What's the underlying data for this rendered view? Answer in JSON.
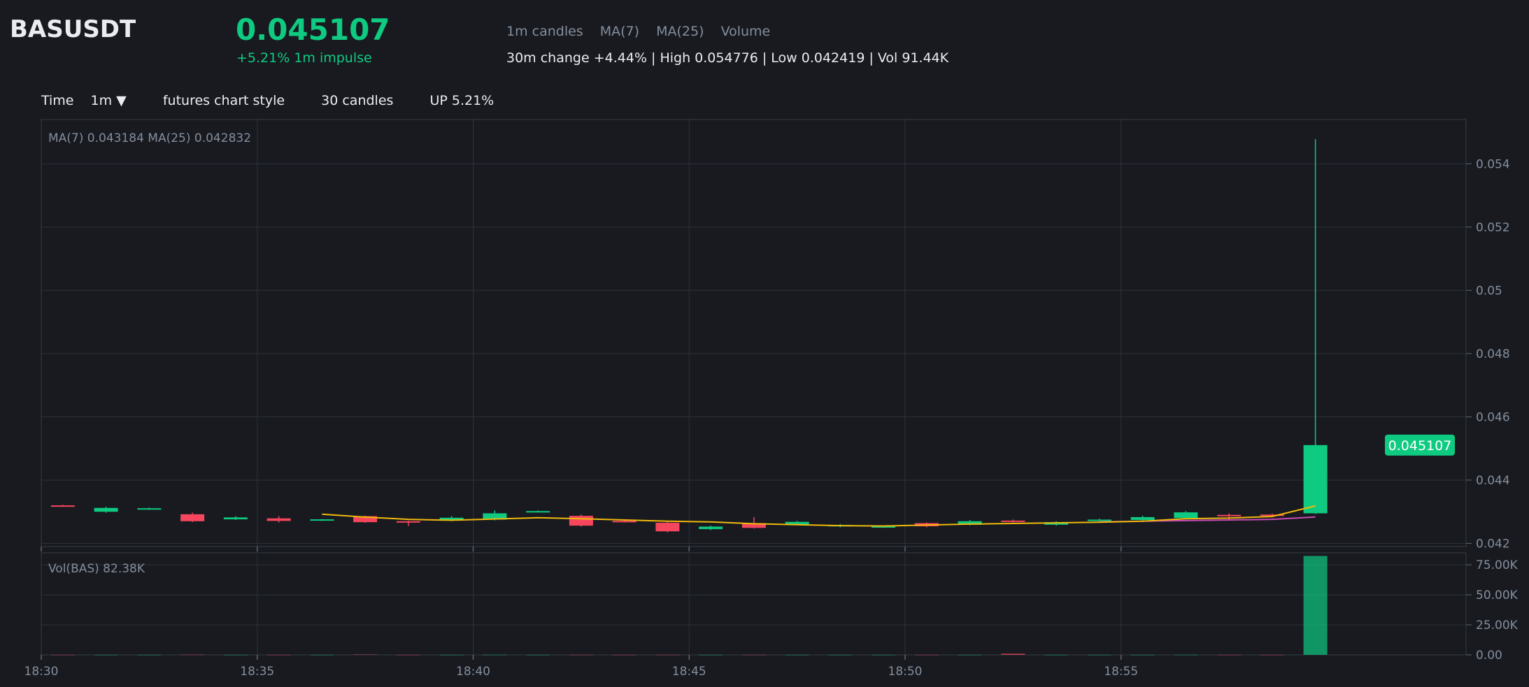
{
  "header": {
    "symbol": "BASUSDT",
    "price": "0.045107",
    "impulse": "+5.21% 1m impulse",
    "legend": [
      "1m candles",
      "MA(7)",
      "MA(25)",
      "Volume"
    ],
    "stats": "30m change +4.44% | High 0.054776 | Low 0.042419 | Vol 91.44K"
  },
  "toolbar": {
    "time_label": "Time",
    "interval": "1m ▼",
    "style": "futures chart style",
    "candles": "30 candles",
    "direction": "UP 5.21%"
  },
  "colors": {
    "background": "#181a20",
    "up": "#0ecb81",
    "down": "#f6465d",
    "ma7": "#f0b90b",
    "ma25": "#c94bb3",
    "grid": "#2b3139",
    "text_muted": "#848e9c"
  },
  "chart_data": {
    "type": "candlestick",
    "price_legend": "MA(7) 0.043184    MA(25) 0.042832",
    "volume_legend": "Vol(BAS) 82.38K",
    "last_price_label": "0.045107",
    "x_ticks": [
      "18:30",
      "18:35",
      "18:40",
      "18:45",
      "18:50",
      "18:55"
    ],
    "y_ticks": [
      "0.054",
      "0.052",
      "0.05",
      "0.048",
      "0.046",
      "0.044",
      "0.042"
    ],
    "y_tick_values": [
      0.054,
      0.052,
      0.05,
      0.048,
      0.046,
      0.044,
      0.042
    ],
    "ylim": [
      0.0419,
      0.0554
    ],
    "vol_ticks": [
      "75.00K",
      "50.00K",
      "25.00K",
      "0.00"
    ],
    "vol_tick_values": [
      75000,
      50000,
      25000,
      0
    ],
    "vol_ylim": [
      0,
      85000
    ],
    "candles": [
      {
        "t": "18:30",
        "o": 0.0432,
        "h": 0.04322,
        "l": 0.04318,
        "c": 0.04319,
        "v": 50
      },
      {
        "t": "18:31",
        "o": 0.043,
        "h": 0.04316,
        "l": 0.04297,
        "c": 0.04312,
        "v": 50
      },
      {
        "t": "18:32",
        "o": 0.04308,
        "h": 0.04313,
        "l": 0.04306,
        "c": 0.04311,
        "v": 50
      },
      {
        "t": "18:33",
        "o": 0.04292,
        "h": 0.04297,
        "l": 0.04267,
        "c": 0.0427,
        "v": 200
      },
      {
        "t": "18:34",
        "o": 0.04276,
        "h": 0.04286,
        "l": 0.04274,
        "c": 0.04282,
        "v": 50
      },
      {
        "t": "18:35",
        "o": 0.04279,
        "h": 0.04286,
        "l": 0.04266,
        "c": 0.04271,
        "v": 50
      },
      {
        "t": "18:36",
        "o": 0.04274,
        "h": 0.04277,
        "l": 0.04271,
        "c": 0.04276,
        "v": 50
      },
      {
        "t": "18:37",
        "o": 0.04286,
        "h": 0.04288,
        "l": 0.04265,
        "c": 0.04267,
        "v": 300
      },
      {
        "t": "18:38",
        "o": 0.0427,
        "h": 0.04272,
        "l": 0.04255,
        "c": 0.04268,
        "v": 50
      },
      {
        "t": "18:39",
        "o": 0.04272,
        "h": 0.04286,
        "l": 0.0427,
        "c": 0.04281,
        "v": 50
      },
      {
        "t": "18:40",
        "o": 0.04275,
        "h": 0.04304,
        "l": 0.04273,
        "c": 0.04295,
        "v": 100
      },
      {
        "t": "18:41",
        "o": 0.043,
        "h": 0.04304,
        "l": 0.04298,
        "c": 0.04302,
        "v": 50
      },
      {
        "t": "18:42",
        "o": 0.04287,
        "h": 0.04291,
        "l": 0.04253,
        "c": 0.04256,
        "v": 100
      },
      {
        "t": "18:43",
        "o": 0.04271,
        "h": 0.04274,
        "l": 0.04266,
        "c": 0.04268,
        "v": 50
      },
      {
        "t": "18:44",
        "o": 0.04265,
        "h": 0.04268,
        "l": 0.04235,
        "c": 0.04238,
        "v": 100
      },
      {
        "t": "18:45",
        "o": 0.04245,
        "h": 0.04256,
        "l": 0.04242,
        "c": 0.04253,
        "v": 50
      },
      {
        "t": "18:46",
        "o": 0.04264,
        "h": 0.04283,
        "l": 0.04247,
        "c": 0.04249,
        "v": 100
      },
      {
        "t": "18:47",
        "o": 0.0426,
        "h": 0.04271,
        "l": 0.04258,
        "c": 0.04268,
        "v": 50
      },
      {
        "t": "18:48",
        "o": 0.04254,
        "h": 0.04261,
        "l": 0.04251,
        "c": 0.04258,
        "v": 50
      },
      {
        "t": "18:49",
        "o": 0.04251,
        "h": 0.04256,
        "l": 0.04249,
        "c": 0.04254,
        "v": 50
      },
      {
        "t": "18:50",
        "o": 0.04264,
        "h": 0.04266,
        "l": 0.04251,
        "c": 0.04254,
        "v": 50
      },
      {
        "t": "18:51",
        "o": 0.04259,
        "h": 0.04274,
        "l": 0.04257,
        "c": 0.0427,
        "v": 50
      },
      {
        "t": "18:52",
        "o": 0.04272,
        "h": 0.04275,
        "l": 0.04266,
        "c": 0.04268,
        "v": 1000
      },
      {
        "t": "18:53",
        "o": 0.04259,
        "h": 0.0427,
        "l": 0.04256,
        "c": 0.04267,
        "v": 50
      },
      {
        "t": "18:54",
        "o": 0.04274,
        "h": 0.04278,
        "l": 0.04271,
        "c": 0.04275,
        "v": 50
      },
      {
        "t": "18:55",
        "o": 0.04274,
        "h": 0.04287,
        "l": 0.04272,
        "c": 0.04283,
        "v": 50
      },
      {
        "t": "18:56",
        "o": 0.0428,
        "h": 0.04302,
        "l": 0.04278,
        "c": 0.04298,
        "v": 100
      },
      {
        "t": "18:57",
        "o": 0.0429,
        "h": 0.04295,
        "l": 0.04276,
        "c": 0.04287,
        "v": 50
      },
      {
        "t": "18:58",
        "o": 0.04291,
        "h": 0.04294,
        "l": 0.04282,
        "c": 0.04288,
        "v": 50
      },
      {
        "t": "18:59",
        "o": 0.04295,
        "h": 0.054776,
        "l": 0.04293,
        "c": 0.045107,
        "v": 82380
      }
    ],
    "ma7": [
      null,
      null,
      null,
      null,
      null,
      null,
      0.04292,
      0.04283,
      0.04276,
      0.04273,
      0.04277,
      0.04281,
      0.04278,
      0.04274,
      0.0427,
      0.04268,
      0.04262,
      0.04259,
      0.04256,
      0.04255,
      0.04258,
      0.04261,
      0.04263,
      0.04265,
      0.04267,
      0.0427,
      0.04278,
      0.0428,
      0.04285,
      0.043184
    ],
    "ma25": [
      null,
      null,
      null,
      null,
      null,
      null,
      null,
      null,
      null,
      null,
      null,
      null,
      null,
      null,
      null,
      null,
      null,
      null,
      null,
      null,
      null,
      null,
      null,
      null,
      0.04268,
      0.0427,
      0.04272,
      0.04274,
      0.04276,
      0.042832
    ]
  }
}
